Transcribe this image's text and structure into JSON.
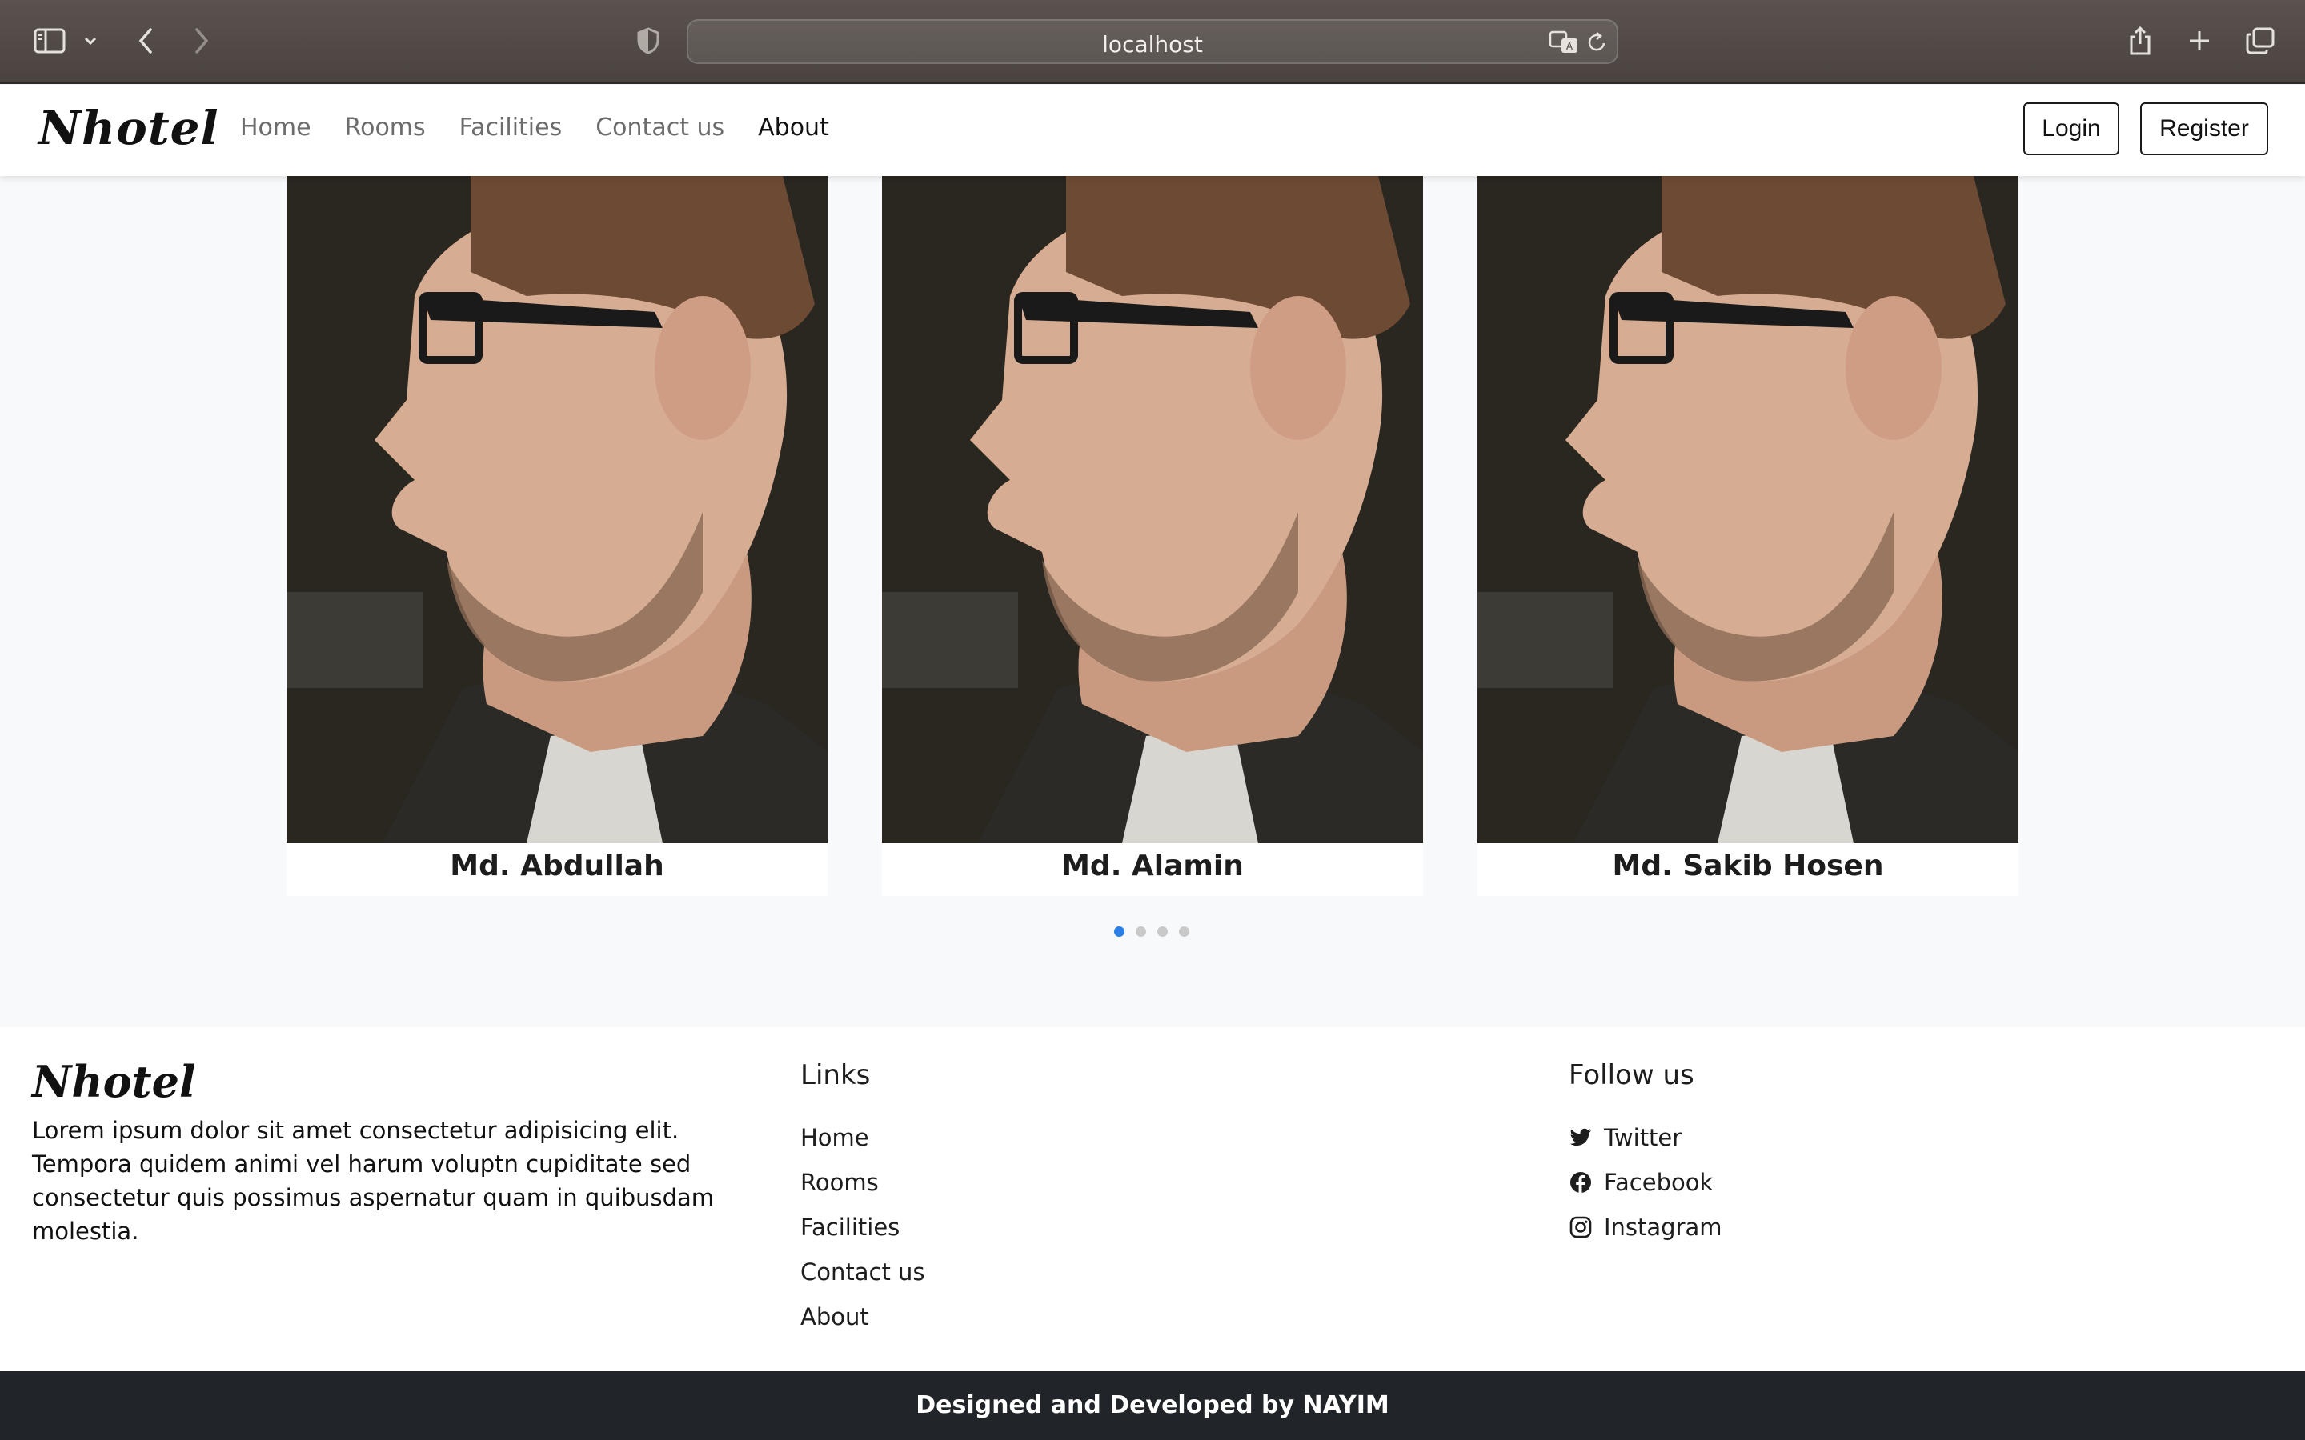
{
  "browser": {
    "url": "localhost",
    "icons": [
      "sidebar-icon",
      "chevron-down-icon",
      "back-icon",
      "forward-icon",
      "shield-icon",
      "translate-icon",
      "reload-icon",
      "share-icon",
      "new-tab-icon",
      "tabs-overview-icon"
    ]
  },
  "navbar": {
    "brand": "Nhotel",
    "links": [
      "Home",
      "Rooms",
      "Facilities",
      "Contact us",
      "About"
    ],
    "active_link": "About",
    "login_label": "Login",
    "register_label": "Register"
  },
  "team": {
    "members": [
      {
        "name": "Md. Abdullah"
      },
      {
        "name": "Md. Alamin"
      },
      {
        "name": "Md. Sakib Hosen"
      }
    ],
    "carousel_dots": 4,
    "active_dot": 0,
    "accent_color": "#2d7fe8"
  },
  "footer": {
    "brand": "Nhotel",
    "about": "Lorem ipsum dolor sit amet consectetur adipisicing elit. Tempora quidem animi vel harum voluptn cupiditate sed consectetur quis possimus aspernatur quam in quibusdam molestia.",
    "links_heading": "Links",
    "links": [
      "Home",
      "Rooms",
      "Facilities",
      "Contact us",
      "About"
    ],
    "follow_heading": "Follow us",
    "social": [
      {
        "label": "Twitter",
        "icon": "twitter-icon"
      },
      {
        "label": "Facebook",
        "icon": "facebook-icon"
      },
      {
        "label": "Instagram",
        "icon": "instagram-icon"
      }
    ]
  },
  "copyright": "Designed and Developed by NAYIM"
}
